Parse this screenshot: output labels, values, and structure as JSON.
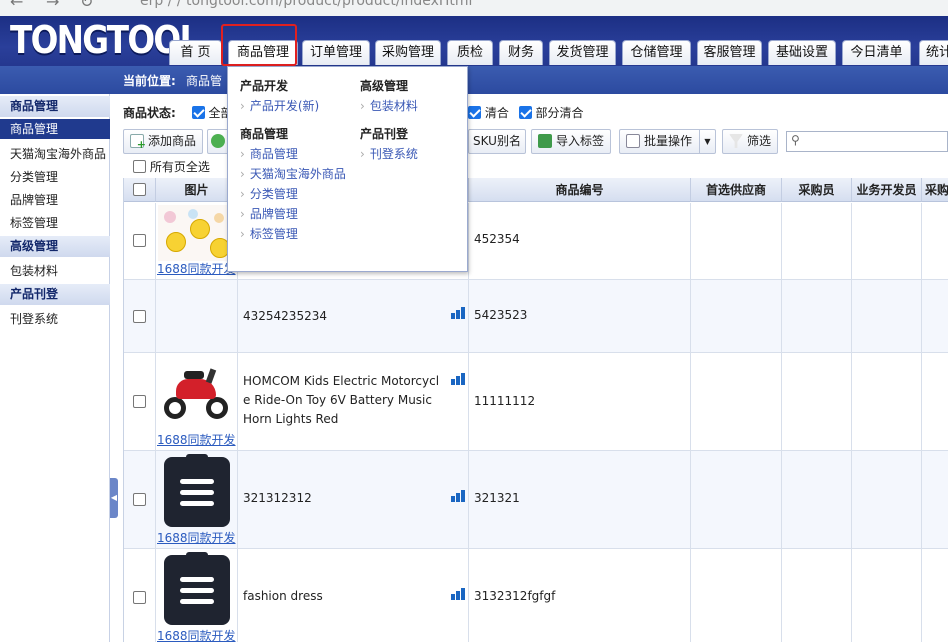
{
  "browser": {
    "url_fragment": "erp / / tongtool.com/product/product/indexHtml"
  },
  "header": {
    "logo": "TONGTOOL"
  },
  "nav": {
    "tabs": [
      "首 页",
      "商品管理",
      "订单管理",
      "采购管理",
      "质检",
      "财务",
      "发货管理",
      "仓储管理",
      "客服管理",
      "基础设置",
      "今日清单",
      "统计"
    ]
  },
  "breadcrumb": {
    "label": "当前位置:",
    "path": "商品管"
  },
  "sidebar": {
    "sections": [
      {
        "title": "商品管理",
        "items": [
          "商品管理",
          "天猫淘宝海外商品",
          "分类管理",
          "品牌管理",
          "标签管理"
        ]
      },
      {
        "title": "高级管理",
        "items": [
          "包装材料"
        ]
      },
      {
        "title": "产品刊登",
        "items": [
          "刊登系统"
        ]
      }
    ]
  },
  "filter": {
    "label": "商品状态:",
    "options": [
      "全部",
      "清合",
      "部分清合"
    ]
  },
  "toolbar": {
    "add_product": "添加商品",
    "sku_alias": "SKU别名",
    "import_tags": "导入标签",
    "batch_ops": "批量操作",
    "filter": "筛选",
    "select_all_pages": "所有页全选"
  },
  "grid": {
    "columns": [
      "图片",
      "商品编号",
      "首选供应商",
      "采购员",
      "业务开发员",
      "采购"
    ],
    "link_label": "1688同款开发",
    "rows": [
      {
        "name": "",
        "sku": "452354",
        "image": "chicks"
      },
      {
        "name": "43254235234",
        "sku": "5423523",
        "image": ""
      },
      {
        "name": "HOMCOM Kids Electric Motorcycle Ride-On Toy 6V Battery Music Horn Lights Red",
        "sku": "11111112",
        "image": "motorcycle"
      },
      {
        "name": "321312312",
        "sku": "321321",
        "image": "clipboard"
      },
      {
        "name": "fashion dress",
        "sku": "3132312fgfgf",
        "image": "clipboard"
      }
    ]
  },
  "dropdown": {
    "col1": [
      {
        "title": "产品开发",
        "items": [
          "产品开发(新)"
        ]
      },
      {
        "title": "商品管理",
        "items": [
          "商品管理",
          "天猫淘宝海外商品",
          "分类管理",
          "品牌管理",
          "标签管理"
        ]
      }
    ],
    "col2": [
      {
        "title": "高级管理",
        "items": [
          "包装材料"
        ]
      },
      {
        "title": "产品刊登",
        "items": [
          "刊登系统"
        ]
      }
    ]
  },
  "colors": {
    "header": "#1c2f84",
    "active": "#203a8e",
    "link": "#2b5bbf",
    "highlight": "#e02020"
  }
}
